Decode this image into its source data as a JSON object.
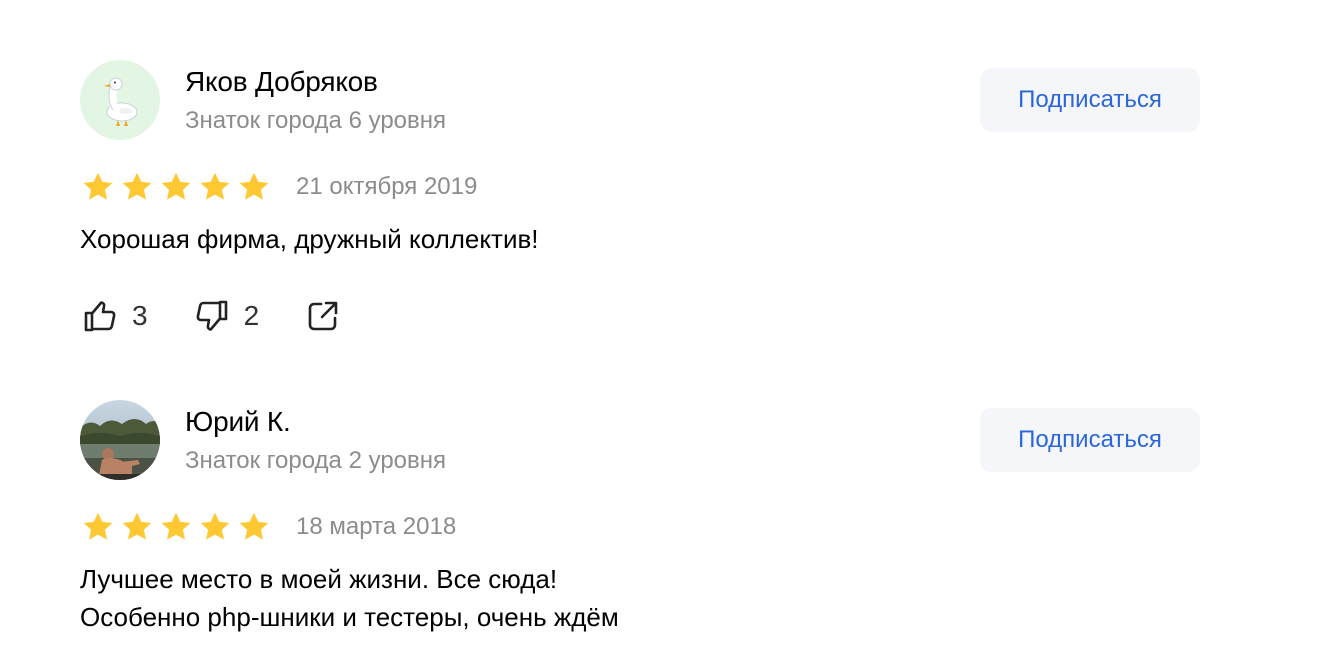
{
  "reviews": [
    {
      "author": {
        "name": "Яков Добряков",
        "level": "Знаток города 6 уровня",
        "avatar_icon": "goose-avatar-icon"
      },
      "subscribe_label": "Подписаться",
      "rating": 5,
      "date": "21 октября 2019",
      "text": "Хорошая фирма, дружный коллектив!",
      "likes": "3",
      "dislikes": "2"
    },
    {
      "author": {
        "name": "Юрий К.",
        "level": "Знаток города 2 уровня",
        "avatar_icon": "user-photo-avatar"
      },
      "subscribe_label": "Подписаться",
      "rating": 5,
      "date": "18 марта 2018",
      "text_lines": [
        "Лучшее место в моей жизни. Все сюда!",
        "Особенно php-шники и тестеры, очень ждём"
      ]
    }
  ],
  "colors": {
    "star": "#fdc832",
    "accent_link": "#2a66d9",
    "muted_text": "#8c8c8c",
    "button_bg": "#f5f6fa"
  }
}
